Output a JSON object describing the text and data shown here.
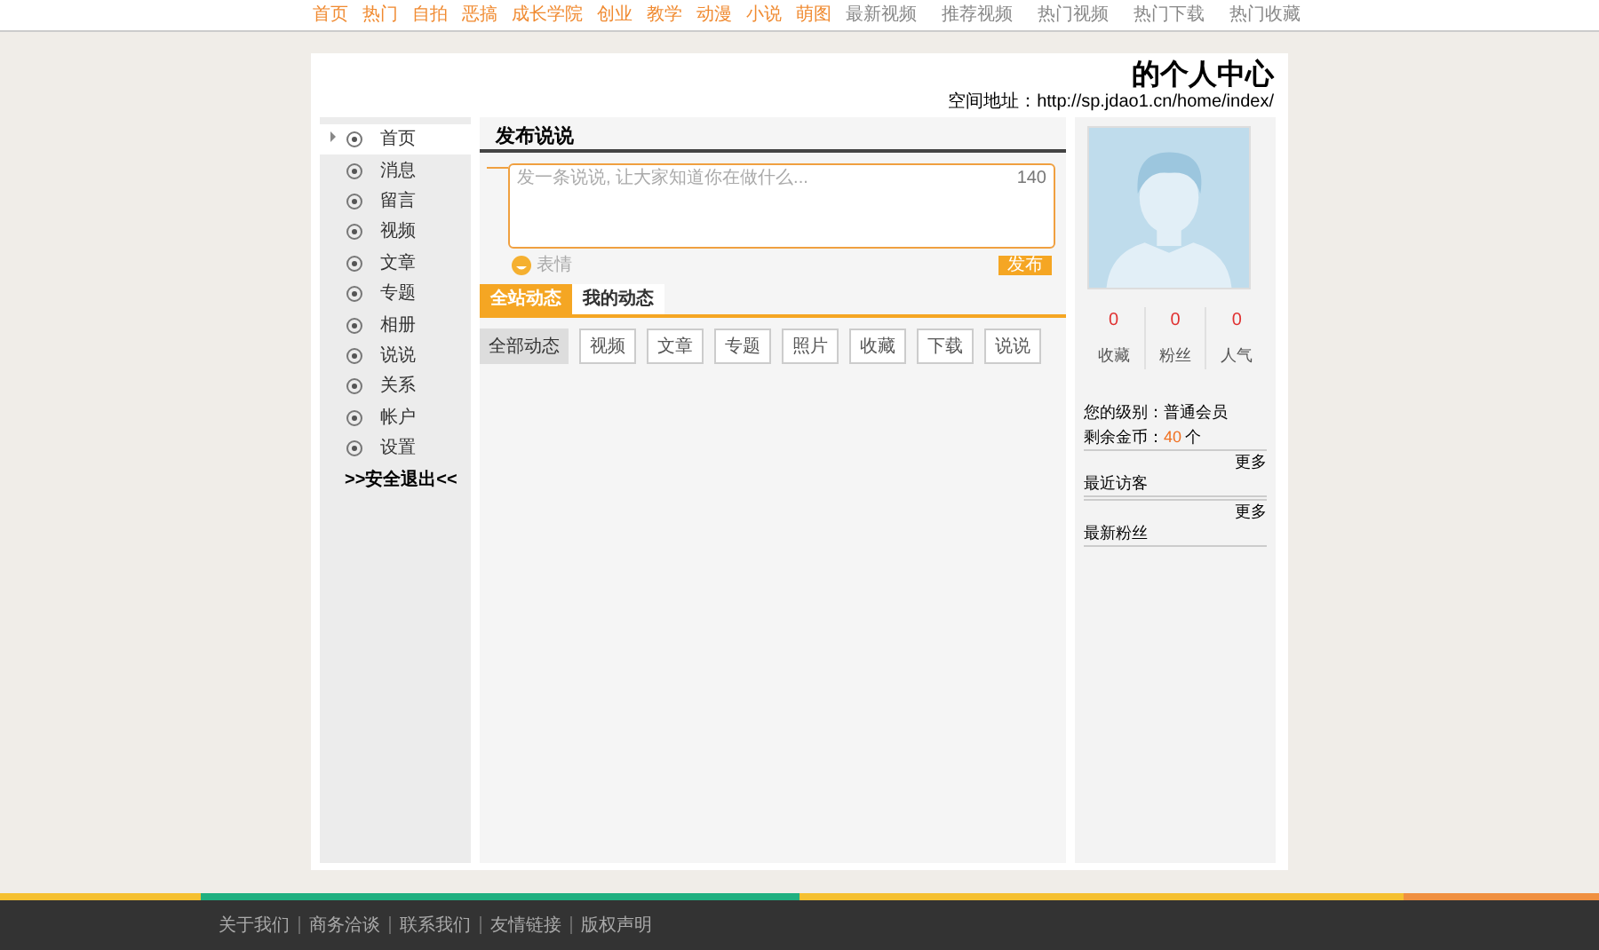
{
  "top_nav": {
    "left": [
      {
        "label": "首页"
      },
      {
        "label": "热门"
      },
      {
        "label": "自拍"
      },
      {
        "label": "恶搞"
      },
      {
        "label": "成长学院"
      },
      {
        "label": "创业"
      },
      {
        "label": "教学"
      },
      {
        "label": "动漫"
      },
      {
        "label": "小说"
      },
      {
        "label": "萌图"
      }
    ],
    "right": [
      {
        "label": "最新视频"
      },
      {
        "label": "推荐视频"
      },
      {
        "label": "热门视频"
      },
      {
        "label": "热门下载"
      },
      {
        "label": "热门收藏"
      }
    ]
  },
  "header": {
    "title": "的个人中心",
    "address_label": "空间地址：",
    "address": "http://sp.jdao1.cn/home/index/"
  },
  "sidebar": {
    "items": [
      {
        "label": "首页",
        "selected": true
      },
      {
        "label": "消息",
        "selected": false
      },
      {
        "label": "留言",
        "selected": false
      },
      {
        "label": "视频",
        "selected": false
      },
      {
        "label": "文章",
        "selected": false
      },
      {
        "label": "专题",
        "selected": false
      },
      {
        "label": "相册",
        "selected": false
      },
      {
        "label": "说说",
        "selected": false
      },
      {
        "label": "关系",
        "selected": false
      },
      {
        "label": "帐户",
        "selected": false
      },
      {
        "label": "设置",
        "selected": false
      }
    ],
    "logout": ">>安全退出<<"
  },
  "post": {
    "heading": "发布说说",
    "placeholder": "发一条说说, 让大家知道你在做什么...",
    "counter": "140",
    "emoji_label": "表情",
    "submit": "发布"
  },
  "tabs": [
    {
      "label": "全站动态",
      "selected": true
    },
    {
      "label": "我的动态",
      "selected": false
    }
  ],
  "filters": [
    {
      "label": "全部动态",
      "selected": true
    },
    {
      "label": "视频",
      "selected": false
    },
    {
      "label": "文章",
      "selected": false
    },
    {
      "label": "专题",
      "selected": false
    },
    {
      "label": "照片",
      "selected": false
    },
    {
      "label": "收藏",
      "selected": false
    },
    {
      "label": "下载",
      "selected": false
    },
    {
      "label": "说说",
      "selected": false
    }
  ],
  "profile": {
    "stats": [
      {
        "value": "0",
        "label": "收藏"
      },
      {
        "value": "0",
        "label": "粉丝"
      },
      {
        "value": "0",
        "label": "人气"
      }
    ],
    "level": "您的级别：普通会员",
    "coins_label": "剩余金币：",
    "coins": "40",
    "coins_unit": "个",
    "sections": [
      {
        "more": "更多",
        "title": "最近访客"
      },
      {
        "more": "更多",
        "title": "最新粉丝"
      }
    ]
  },
  "footer": {
    "links": [
      {
        "label": "关于我们"
      },
      {
        "label": "商务洽谈"
      },
      {
        "label": "联系我们"
      },
      {
        "label": "友情链接"
      },
      {
        "label": "版权声明"
      }
    ]
  }
}
